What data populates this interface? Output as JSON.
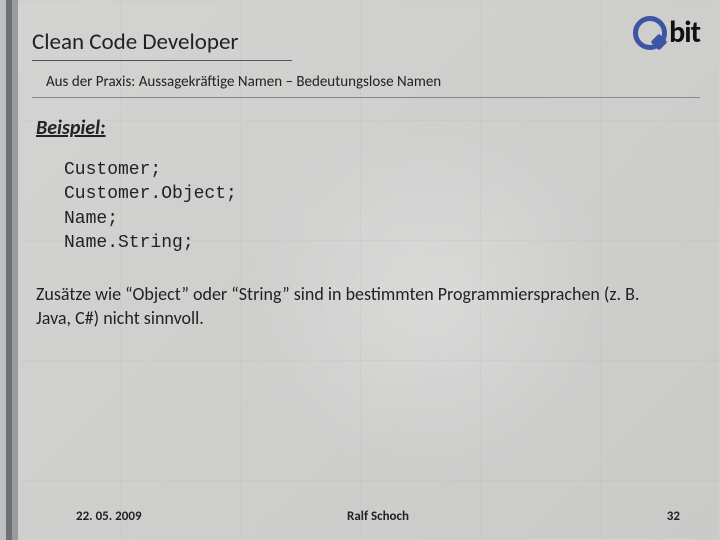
{
  "header": {
    "title": "Clean Code Developer",
    "logo_text": "bit"
  },
  "subtitle": "Aus der Praxis: Aussagekräftige Namen – Bedeutungslose Namen",
  "content": {
    "example_label": "Beispiel:",
    "code_lines": "Customer;\nCustomer.Object;\nName;\nName.String;",
    "body_text": "Zusätze wie “Object” oder “String” sind in bestimmten Programmiersprachen (z. B. Java, C#) nicht sinnvoll."
  },
  "footer": {
    "date": "22. 05. 2009",
    "author": "Ralf Schoch",
    "page": "32"
  }
}
